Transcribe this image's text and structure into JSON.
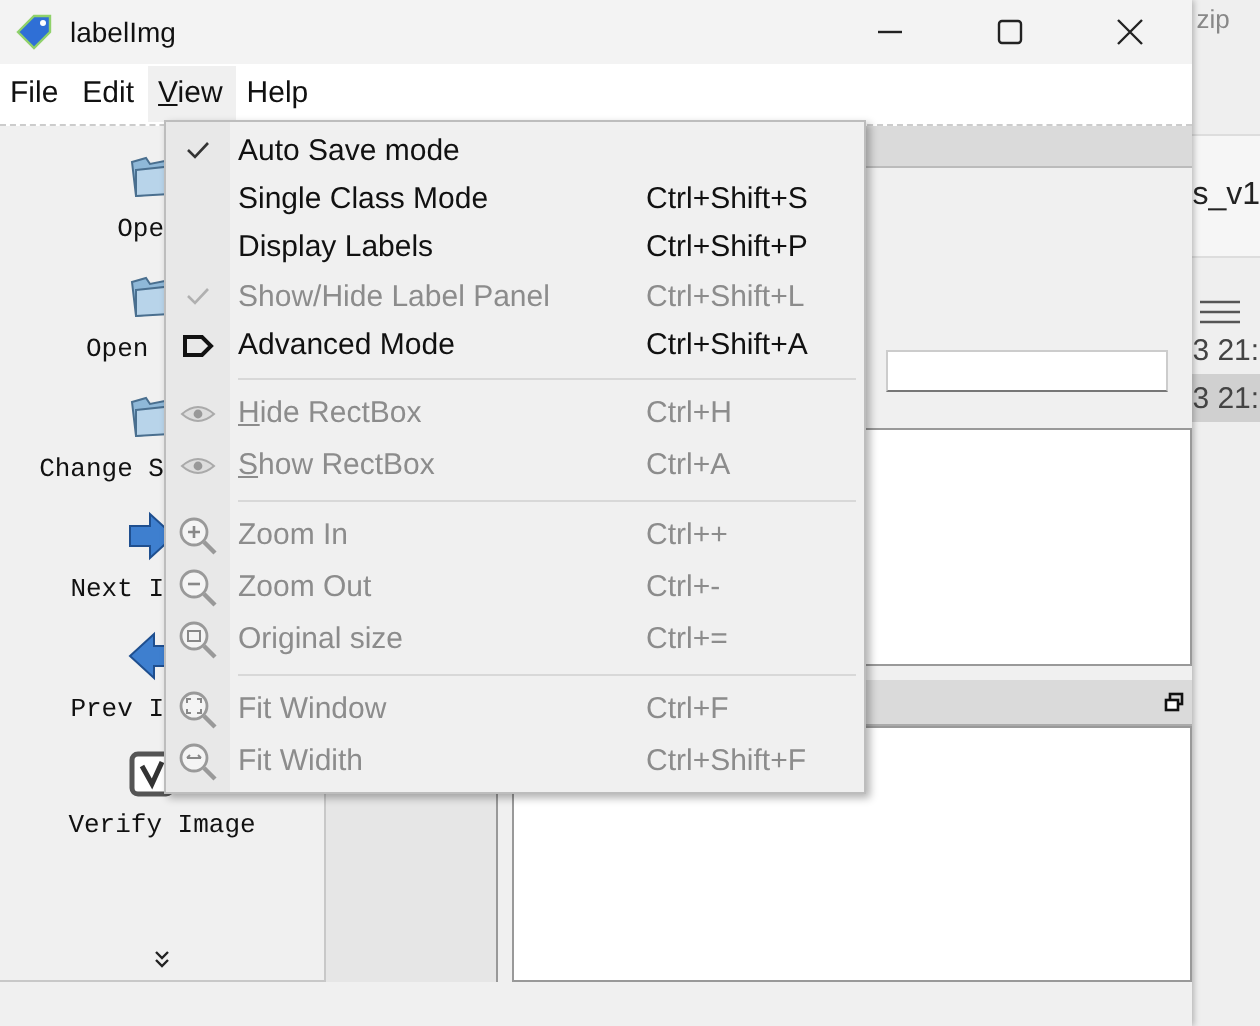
{
  "window": {
    "title": "labelImg"
  },
  "menubar": [
    {
      "label": "File",
      "selected": false,
      "underline_first": false
    },
    {
      "label": "Edit",
      "selected": false,
      "underline_first": false
    },
    {
      "label": "View",
      "selected": true,
      "underline_first": true
    },
    {
      "label": "Help",
      "selected": false,
      "underline_first": false
    }
  ],
  "toolbar": {
    "items": [
      {
        "label": "Ope",
        "kind": "folder",
        "covered": true
      },
      {
        "label": "Open ",
        "kind": "folder",
        "covered": true
      },
      {
        "label": "Change S",
        "kind": "folder",
        "covered": true
      },
      {
        "label": "Next I",
        "kind": "next",
        "covered": true
      },
      {
        "label": "Prev I",
        "kind": "prev",
        "covered": true
      },
      {
        "label": "Verify Image",
        "kind": "verify",
        "covered": false
      }
    ]
  },
  "view_menu": {
    "groups": [
      [
        {
          "kind": "check",
          "label": "Auto Save mode",
          "checked": true,
          "disabled": false,
          "underline_first": false
        },
        {
          "kind": "check",
          "label": "Single Class Mode",
          "shortcut": "Ctrl+Shift+S",
          "checked": false,
          "disabled": false,
          "underline_first": false
        },
        {
          "kind": "check",
          "label": "Display Labels",
          "shortcut": "Ctrl+Shift+P",
          "checked": false,
          "disabled": false,
          "underline_first": false
        },
        {
          "kind": "check",
          "label": "Show/Hide Label Panel",
          "shortcut": "Ctrl+Shift+L",
          "checked": true,
          "disabled": true,
          "underline_first": false
        },
        {
          "kind": "tag",
          "label": "Advanced Mode",
          "shortcut": "Ctrl+Shift+A",
          "disabled": false,
          "underline_first": false
        }
      ],
      [
        {
          "kind": "eye",
          "label": "Hide RectBox",
          "shortcut": "Ctrl+H",
          "disabled": true,
          "underline_first": true
        },
        {
          "kind": "eye",
          "label": "Show RectBox",
          "shortcut": "Ctrl+A",
          "disabled": true,
          "underline_first": true
        }
      ],
      [
        {
          "kind": "zoom-in",
          "label": "Zoom In",
          "shortcut": "Ctrl++",
          "disabled": true,
          "underline_first": false
        },
        {
          "kind": "zoom-out",
          "label": "Zoom Out",
          "shortcut": "Ctrl+-",
          "disabled": true,
          "underline_first": false
        },
        {
          "kind": "zoom-original",
          "label": "Original size",
          "shortcut": "Ctrl+=",
          "disabled": true,
          "underline_first": false
        }
      ],
      [
        {
          "kind": "fit-window",
          "label": "Fit Window",
          "shortcut": "Ctrl+F",
          "disabled": true,
          "underline_first": false
        },
        {
          "kind": "fit-width",
          "label": "Fit Widith",
          "shortcut": "Ctrl+Shift+F",
          "disabled": true,
          "underline_first": false
        }
      ]
    ]
  },
  "background_window": {
    "title_fragment": "zip",
    "name_fragment": "s_v1",
    "rows": [
      {
        "text": "3 21:",
        "selected": false
      },
      {
        "text": "3 21:",
        "selected": true
      }
    ]
  }
}
